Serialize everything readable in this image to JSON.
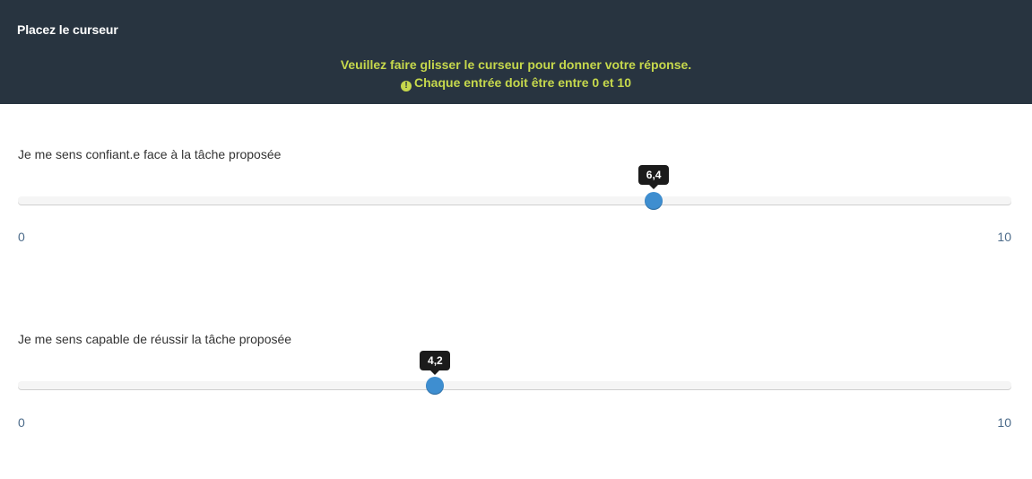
{
  "header": {
    "title": "Placez le curseur",
    "instruction": "Veuillez faire glisser le curseur pour donner votre réponse.",
    "warning_icon": "exclamation-circle-icon",
    "warning": "Chaque entrée doit être entre 0 et 10",
    "background_color": "#283440",
    "instruction_color": "#c6d84c"
  },
  "questions": [
    {
      "label": "Je me sens confiant.e face à la tâche proposée",
      "value": 6.4,
      "value_display": "6,4",
      "min": "0",
      "max": "10"
    },
    {
      "label": "Je me sens capable de réussir la tâche proposée",
      "value": 4.2,
      "value_display": "4,2",
      "min": "0",
      "max": "10"
    }
  ],
  "colors": {
    "handle": "#3e8ed0",
    "tick": "#4c6b8a"
  }
}
